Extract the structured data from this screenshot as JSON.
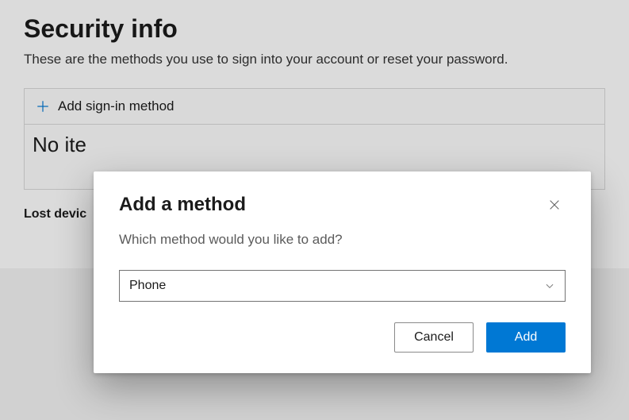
{
  "page": {
    "title": "Security info",
    "subtitle": "These are the methods you use to sign into your account or reset your password.",
    "add_sign_in_method_label": "Add sign-in method",
    "empty_text": "No ite",
    "lost_device_label": "Lost devic"
  },
  "modal": {
    "title": "Add a method",
    "prompt": "Which method would you like to add?",
    "selected_option": "Phone",
    "cancel_label": "Cancel",
    "add_label": "Add"
  },
  "colors": {
    "accent": "#0078d4"
  }
}
